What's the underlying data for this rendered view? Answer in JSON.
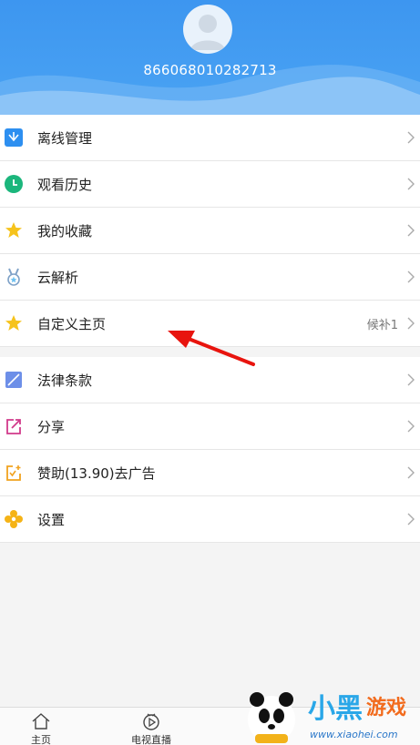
{
  "header": {
    "user_id": "866068010282713",
    "bg_color": "#3d96f0"
  },
  "menu_group1": [
    {
      "label": "离线管理",
      "icon": "download-box-icon",
      "extra": ""
    },
    {
      "label": "观看历史",
      "icon": "clock-icon",
      "extra": ""
    },
    {
      "label": "我的收藏",
      "icon": "star-icon",
      "extra": ""
    },
    {
      "label": "云解析",
      "icon": "medal-icon",
      "extra": ""
    },
    {
      "label": "自定义主页",
      "icon": "star-icon",
      "extra": "候补1"
    }
  ],
  "menu_group2": [
    {
      "label": "法律条款",
      "icon": "document-icon",
      "extra": ""
    },
    {
      "label": "分享",
      "icon": "share-icon",
      "extra": ""
    },
    {
      "label": "赞助(13.90)去广告",
      "icon": "sponsor-icon",
      "extra": ""
    },
    {
      "label": "设置",
      "icon": "gear-flower-icon",
      "extra": ""
    }
  ],
  "tabbar": [
    {
      "label": "主页",
      "icon": "home-icon"
    },
    {
      "label": "电视直播",
      "icon": "tv-play-icon"
    }
  ],
  "watermark": {
    "text_cn": "小黑游戏",
    "url": "www.xiaohei.com"
  },
  "colors": {
    "accent": "#3d96f0",
    "arrow": "#e8140e"
  }
}
